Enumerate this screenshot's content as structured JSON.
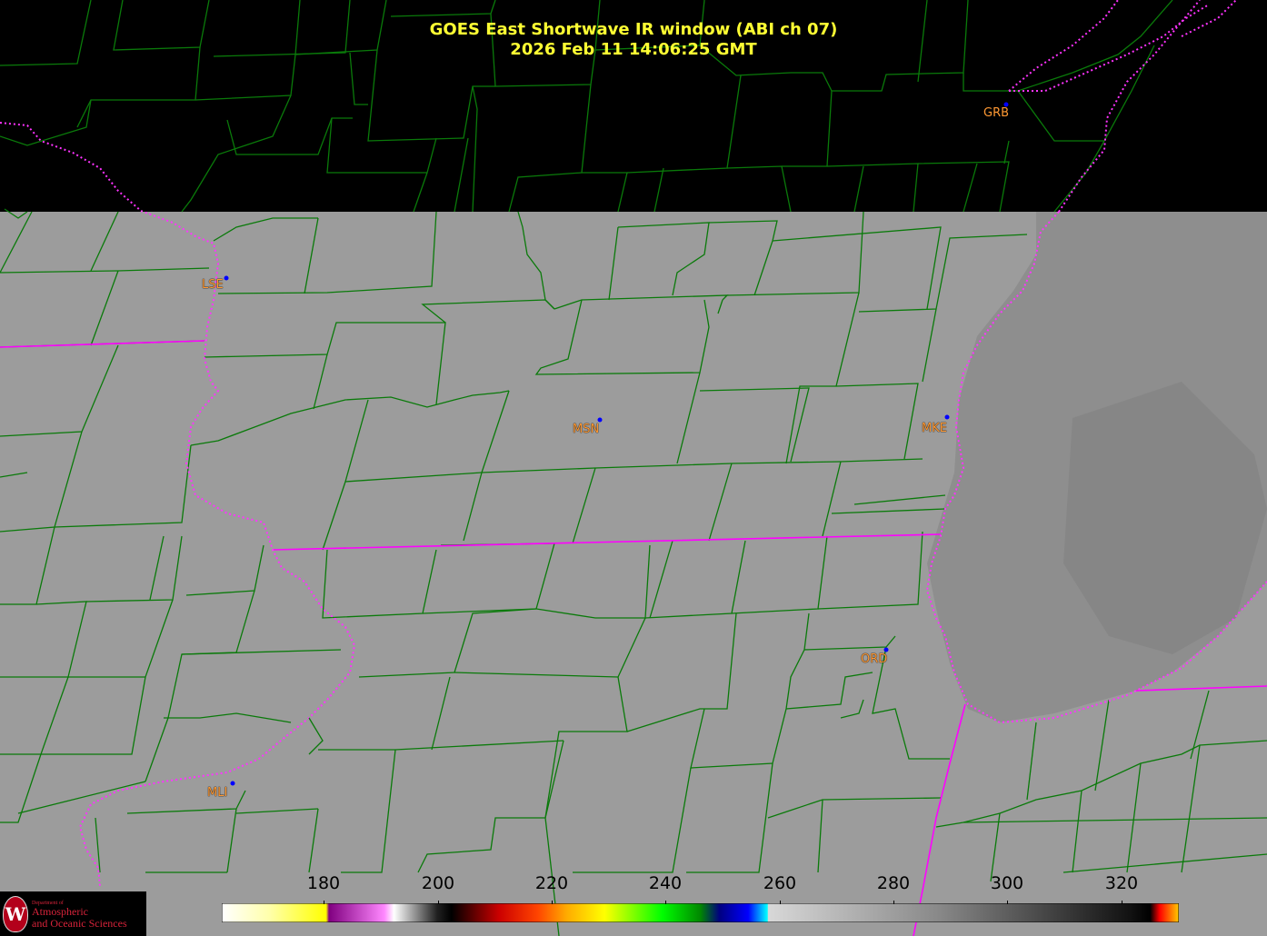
{
  "title": {
    "line1": "GOES East Shortwave IR window (ABI ch 07)",
    "line2": "2026 Feb 11  14:06:25 GMT"
  },
  "stations": [
    {
      "code": "GRB"
    },
    {
      "code": "LSE"
    },
    {
      "code": "MSN"
    },
    {
      "code": "MKE"
    },
    {
      "code": "ORD"
    },
    {
      "code": "MLI"
    }
  ],
  "colorbar": {
    "ticks": [
      "180",
      "200",
      "220",
      "240",
      "260",
      "280",
      "300",
      "320"
    ]
  },
  "logo": {
    "dept": "Department of",
    "name_line1": "Atmospheric",
    "name_line2": "and Oceanic Sciences",
    "seal": "W"
  },
  "colors": {
    "title": "#ffff33",
    "county_lines": "#0a7a0a",
    "state_lines": "#ff00ff",
    "station_label": "#ff9933",
    "station_dot": "#0000ff",
    "land_gray": "#9a9a9a",
    "no_data": "#000000"
  }
}
